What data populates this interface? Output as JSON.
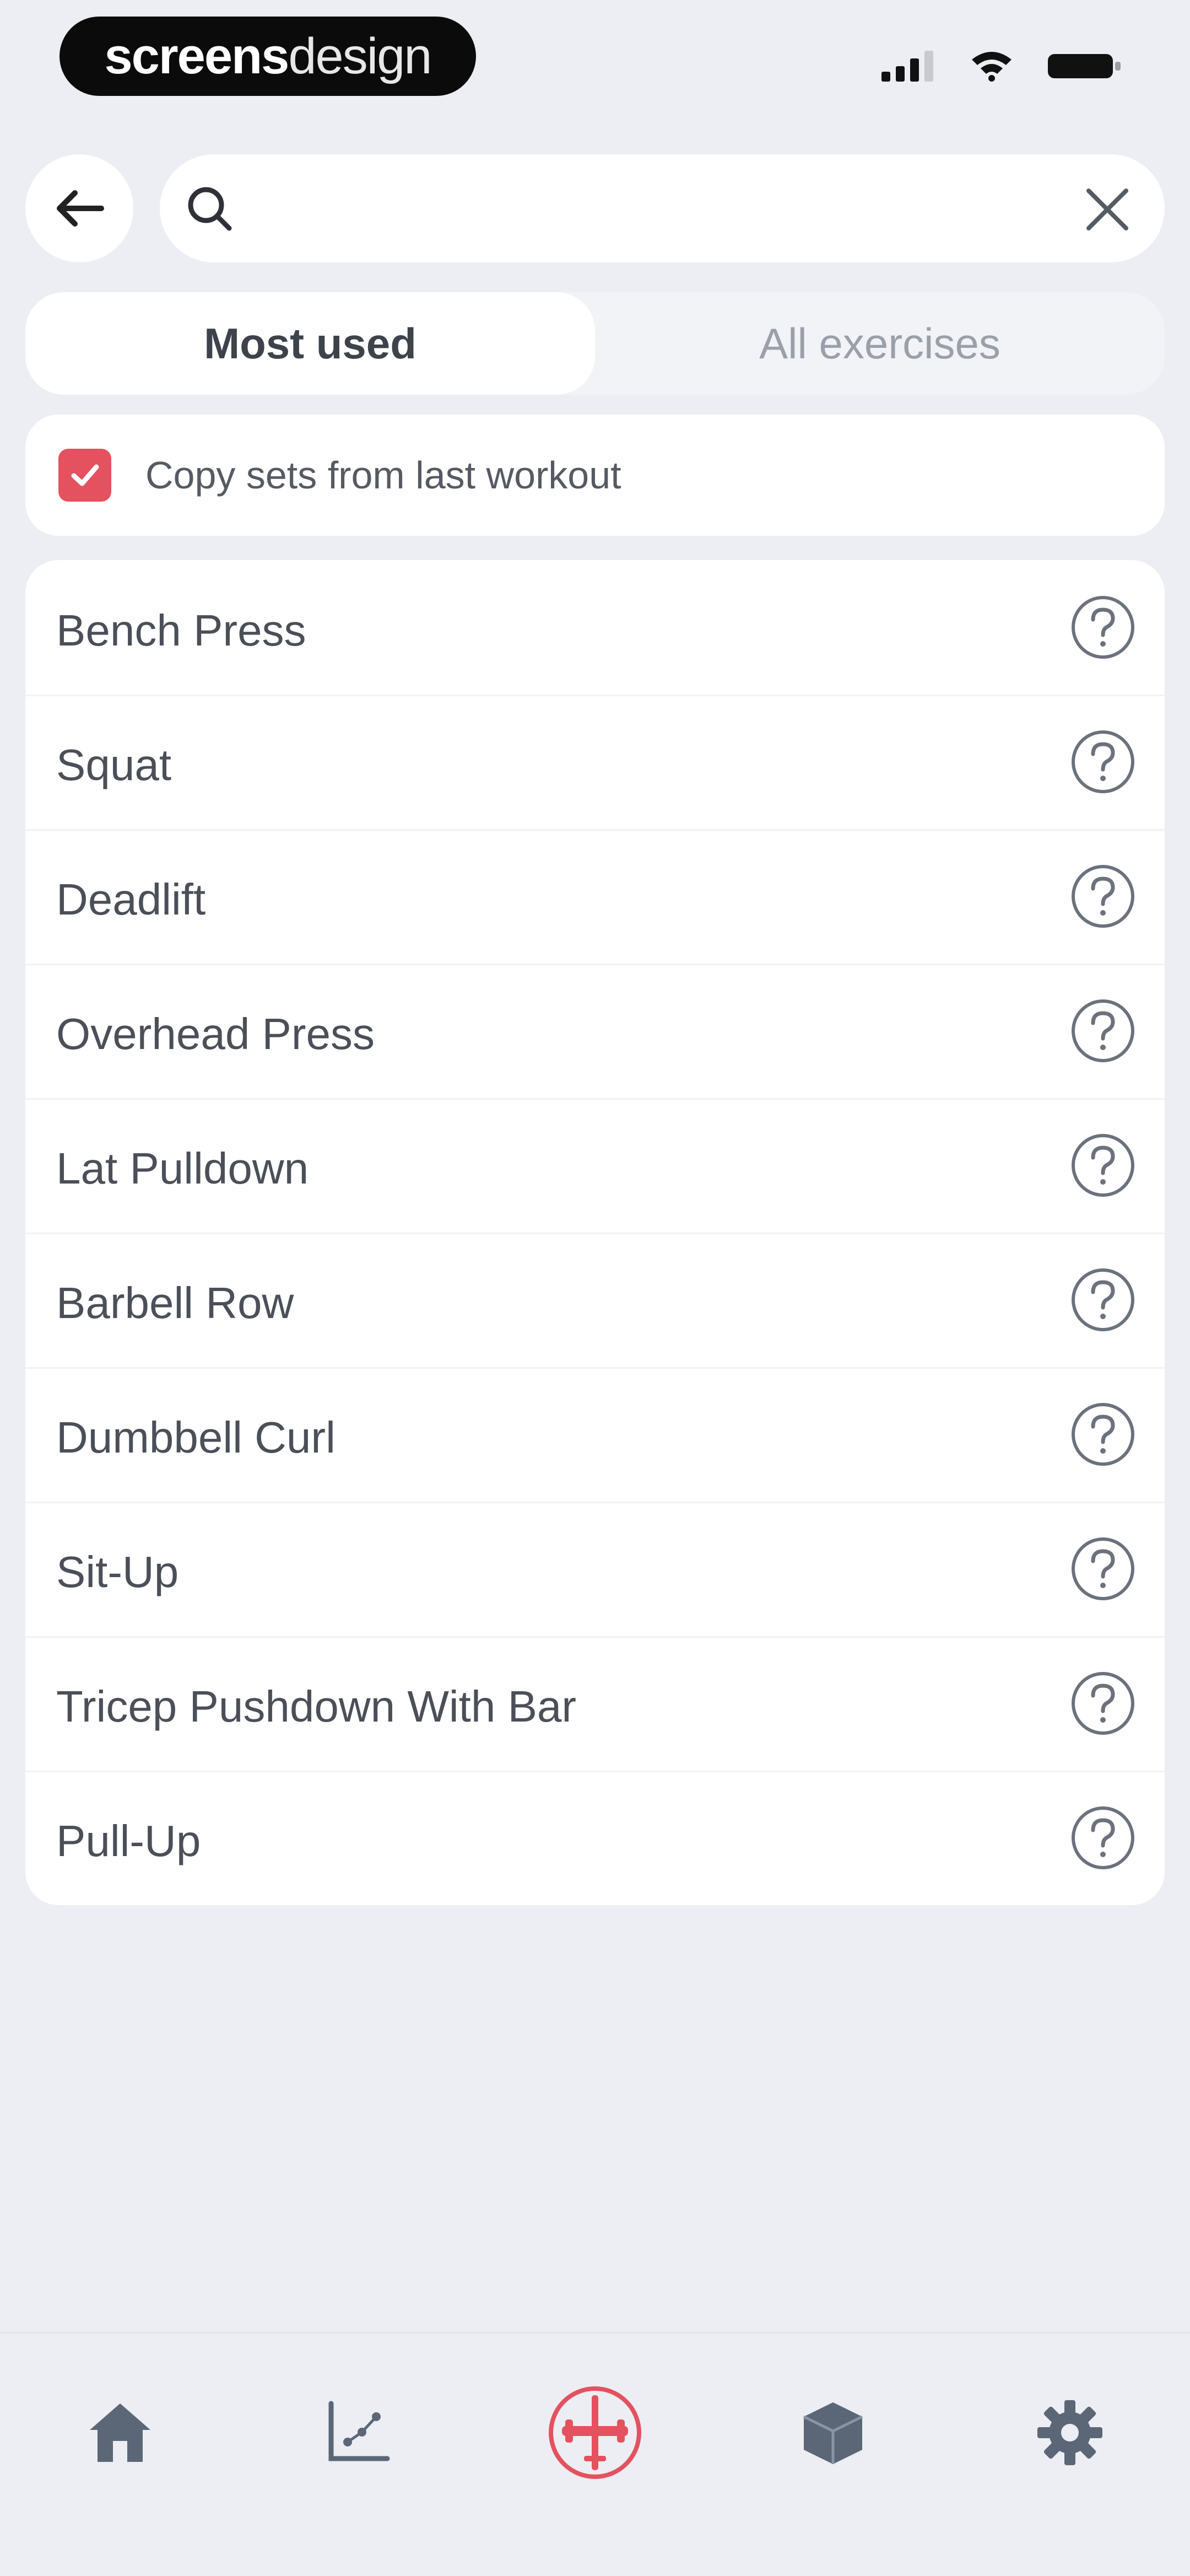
{
  "status_bar": {
    "brand_bold": "screens",
    "brand_light": "design"
  },
  "search": {
    "value": "",
    "placeholder": ""
  },
  "tabs": [
    {
      "label": "Most used",
      "active": true
    },
    {
      "label": "All exercises",
      "active": false
    }
  ],
  "copy_sets": {
    "label": "Copy sets from last workout",
    "checked": true
  },
  "exercises": [
    {
      "name": "Bench Press"
    },
    {
      "name": "Squat"
    },
    {
      "name": "Deadlift"
    },
    {
      "name": "Overhead Press"
    },
    {
      "name": "Lat Pulldown"
    },
    {
      "name": "Barbell Row"
    },
    {
      "name": "Dumbbell Curl"
    },
    {
      "name": "Sit-Up"
    },
    {
      "name": "Tricep Pushdown With Bar"
    },
    {
      "name": "Pull-Up"
    }
  ],
  "bottom_nav": {
    "items": [
      "home-icon",
      "chart-icon",
      "workout-icon",
      "cube-icon",
      "gear-icon"
    ],
    "active": "workout-icon"
  },
  "colors": {
    "accent": "#e4515f",
    "background": "#eceef3",
    "card": "#ffffff",
    "icon": "#5b6676"
  }
}
